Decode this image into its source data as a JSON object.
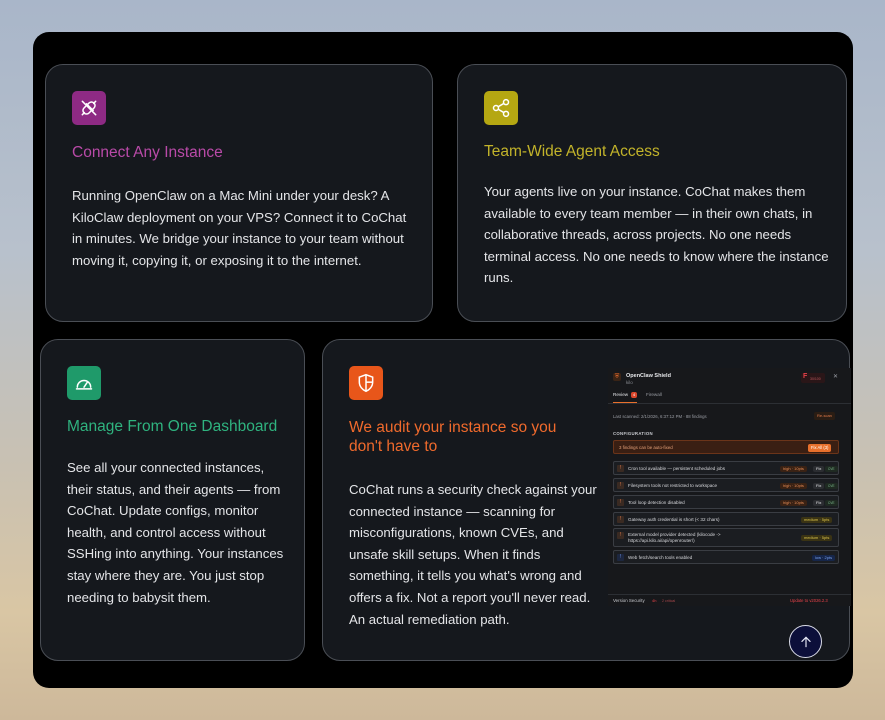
{
  "cards": [
    {
      "title": "Connect Any Instance",
      "body": "Running OpenClaw on a Mac Mini under your desk? A KiloClaw deployment on your VPS? Connect it to CoChat in minutes. We bridge your instance to your team without moving it, copying it, or exposing it to the internet.",
      "icon": "plug-off-icon",
      "accent": "#9b2e8c",
      "title_color": "#b94aa8"
    },
    {
      "title": "Team-Wide Agent Access",
      "body": "Your agents live on your instance. CoChat makes them available to every team member — in their own chats, in collaborative threads, across projects. No one needs terminal access. No one needs to know where the instance runs.",
      "icon": "share-icon",
      "accent": "#b3a714",
      "title_color": "#c2b32a"
    },
    {
      "title": "Manage From One Dashboard",
      "body": "See all your connected instances, their status, and their agents — from CoChat. Update configs, monitor health, and control access without SSHing into anything. Your instances stay where they are. You just stop needing to babysit them.",
      "icon": "gauge-icon",
      "accent": "#1f9a6a",
      "title_color": "#2fb37f"
    },
    {
      "title": "We audit your instance so you don't have to",
      "body": "CoChat runs a security check against your connected instance — scanning for misconfigurations, known CVEs, and unsafe skill setups. When it finds something, it tells you what's wrong and offers a fix. Not a report you'll never read. An actual remediation path.",
      "icon": "shield-icon",
      "accent": "#e85a1c",
      "title_color": "#f06a2c"
    }
  ],
  "shield_panel": {
    "title": "OpenClaw Shield",
    "subtitle": "kilo",
    "grade": "F",
    "grade_sub": "30/100",
    "tabs": [
      "Review",
      "Firewall"
    ],
    "review_count": "4",
    "last_scanned": "Last scanned: 2/1/2026, 6:37:12 PM · 88 findings",
    "rescan": "Re-scan",
    "section": "CONFIGURATION",
    "autofix_text": "3 findings can be auto-fixed",
    "autofix_btn": "Fix All (3)",
    "findings": [
      {
        "text": "Cron tool available — persistent scheduled jobs",
        "sev": "high · 10pts",
        "fix": "Fix",
        "extra": "CVE"
      },
      {
        "text": "Filesystem tools not restricted to workspace",
        "sev": "high · 10pts",
        "fix": "Fix",
        "extra": "CVE"
      },
      {
        "text": "Tool loop detection disabled",
        "sev": "high · 10pts",
        "fix": "Fix",
        "extra": "CVE"
      },
      {
        "text": "Gateway auth credential is short (< 32 chars)",
        "sev": "medium · 5pts"
      },
      {
        "text": "External model provider detected (kilocode -> https://api.kilo.ai/api/openrouter/)",
        "sev": "medium · 5pts"
      },
      {
        "text": "Web fetch/search tools enabled",
        "sev": "low · 2pts"
      }
    ],
    "footer_left": "Version Security",
    "footer_badge": "4h",
    "footer_badge2": "2 critical",
    "footer_right": "Update to v2026.2.3"
  },
  "scroll_top_icon": "arrow-up-icon"
}
